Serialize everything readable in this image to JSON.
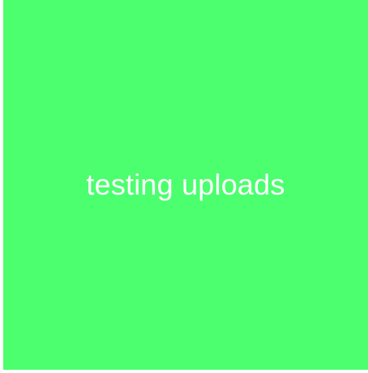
{
  "tile": {
    "text": "testing uploads",
    "background_color": "#4bff6e",
    "text_color": "#ffffff"
  }
}
